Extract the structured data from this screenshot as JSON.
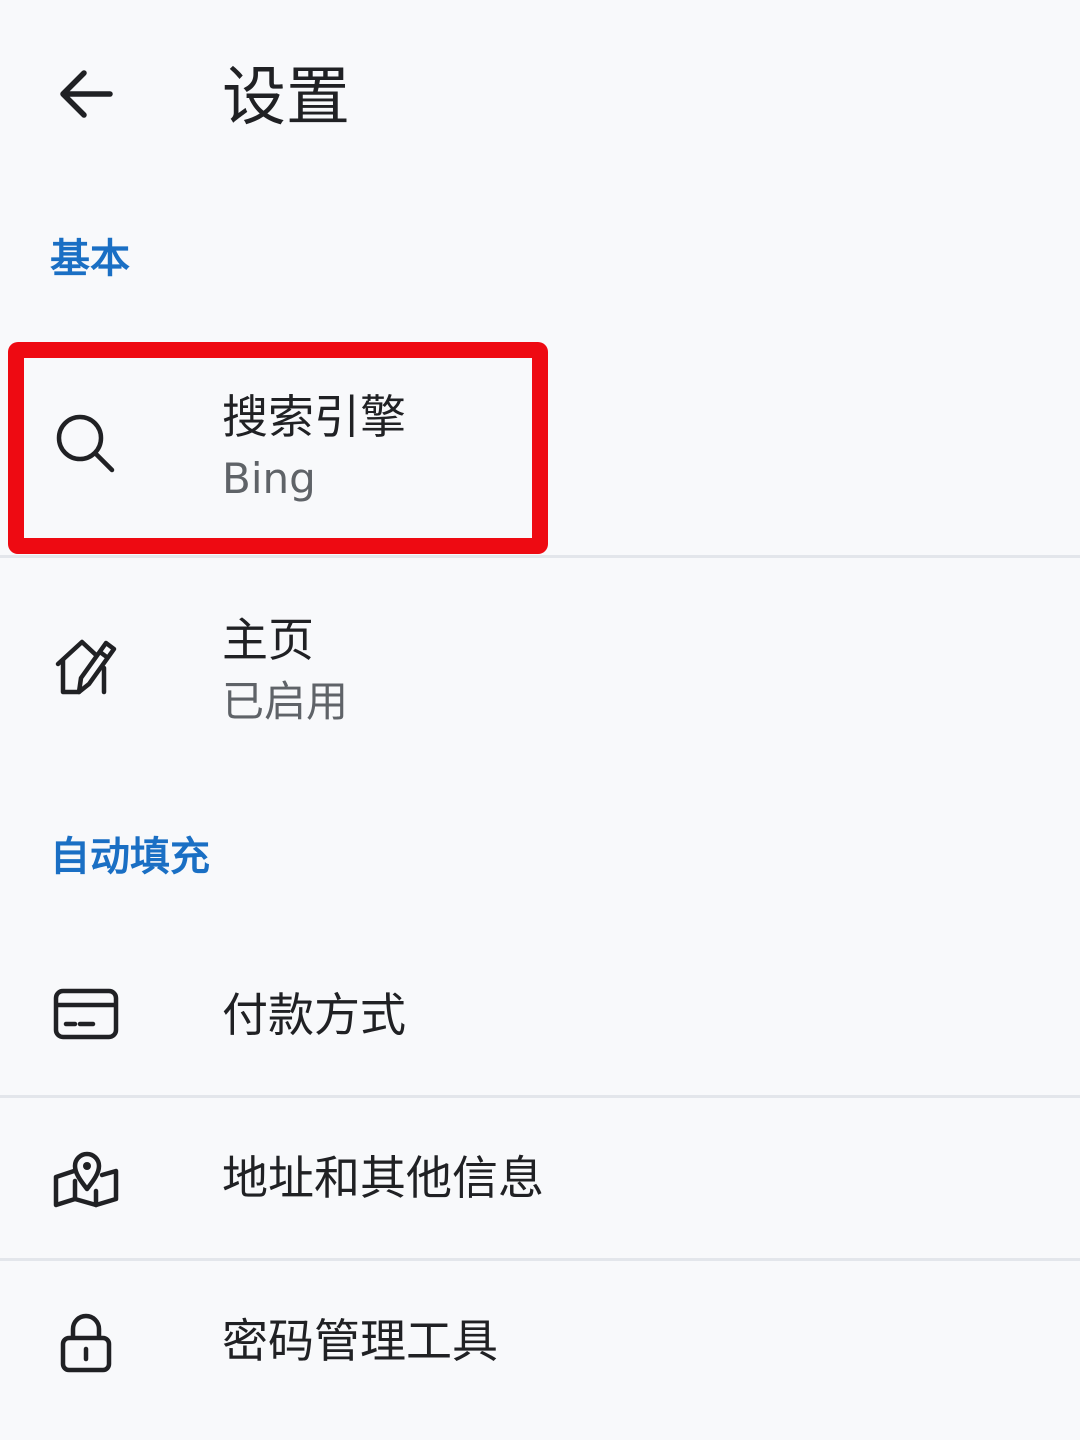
{
  "header": {
    "title": "设置",
    "back_icon": "arrow-left-icon"
  },
  "sections": {
    "basic": {
      "title": "基本",
      "items": [
        {
          "icon": "search-icon",
          "label": "搜索引擎",
          "value": "Bing"
        },
        {
          "icon": "home-edit-icon",
          "label": "主页",
          "value": "已启用"
        }
      ]
    },
    "autofill": {
      "title": "自动填充",
      "items": [
        {
          "icon": "credit-card-icon",
          "label": "付款方式"
        },
        {
          "icon": "map-pin-icon",
          "label": "地址和其他信息"
        },
        {
          "icon": "lock-icon",
          "label": "密码管理工具"
        }
      ]
    }
  },
  "colors": {
    "background": "#f8f9fb",
    "section_accent": "#1a6fc4",
    "highlight_border": "#ee0a12",
    "text_primary": "#202124",
    "text_secondary": "#5f6368"
  }
}
